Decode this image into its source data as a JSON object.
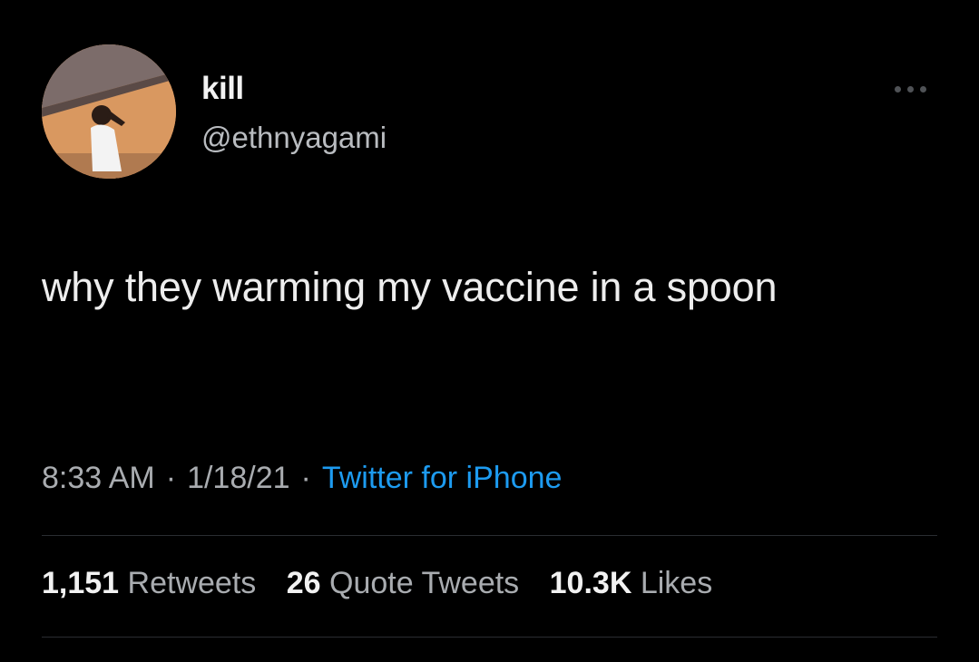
{
  "user": {
    "display_name": "kill",
    "handle": "@ethnyagami",
    "avatar_icon": "profile-avatar"
  },
  "more_icon": "more-options-icon",
  "tweet": {
    "text": "why they warming my vaccine in a spoon"
  },
  "meta": {
    "time": "8:33 AM",
    "separator": "·",
    "date": "1/18/21",
    "source": "Twitter for iPhone"
  },
  "stats": {
    "retweets": {
      "count": "1,151",
      "label": "Retweets"
    },
    "quotes": {
      "count": "26",
      "label": "Quote Tweets"
    },
    "likes": {
      "count": "10.3K",
      "label": "Likes"
    }
  },
  "colors": {
    "background": "#000000",
    "text": "#ededed",
    "muted": "#a9acb0",
    "link": "#1d9bf0",
    "divider": "#2a2d31"
  }
}
